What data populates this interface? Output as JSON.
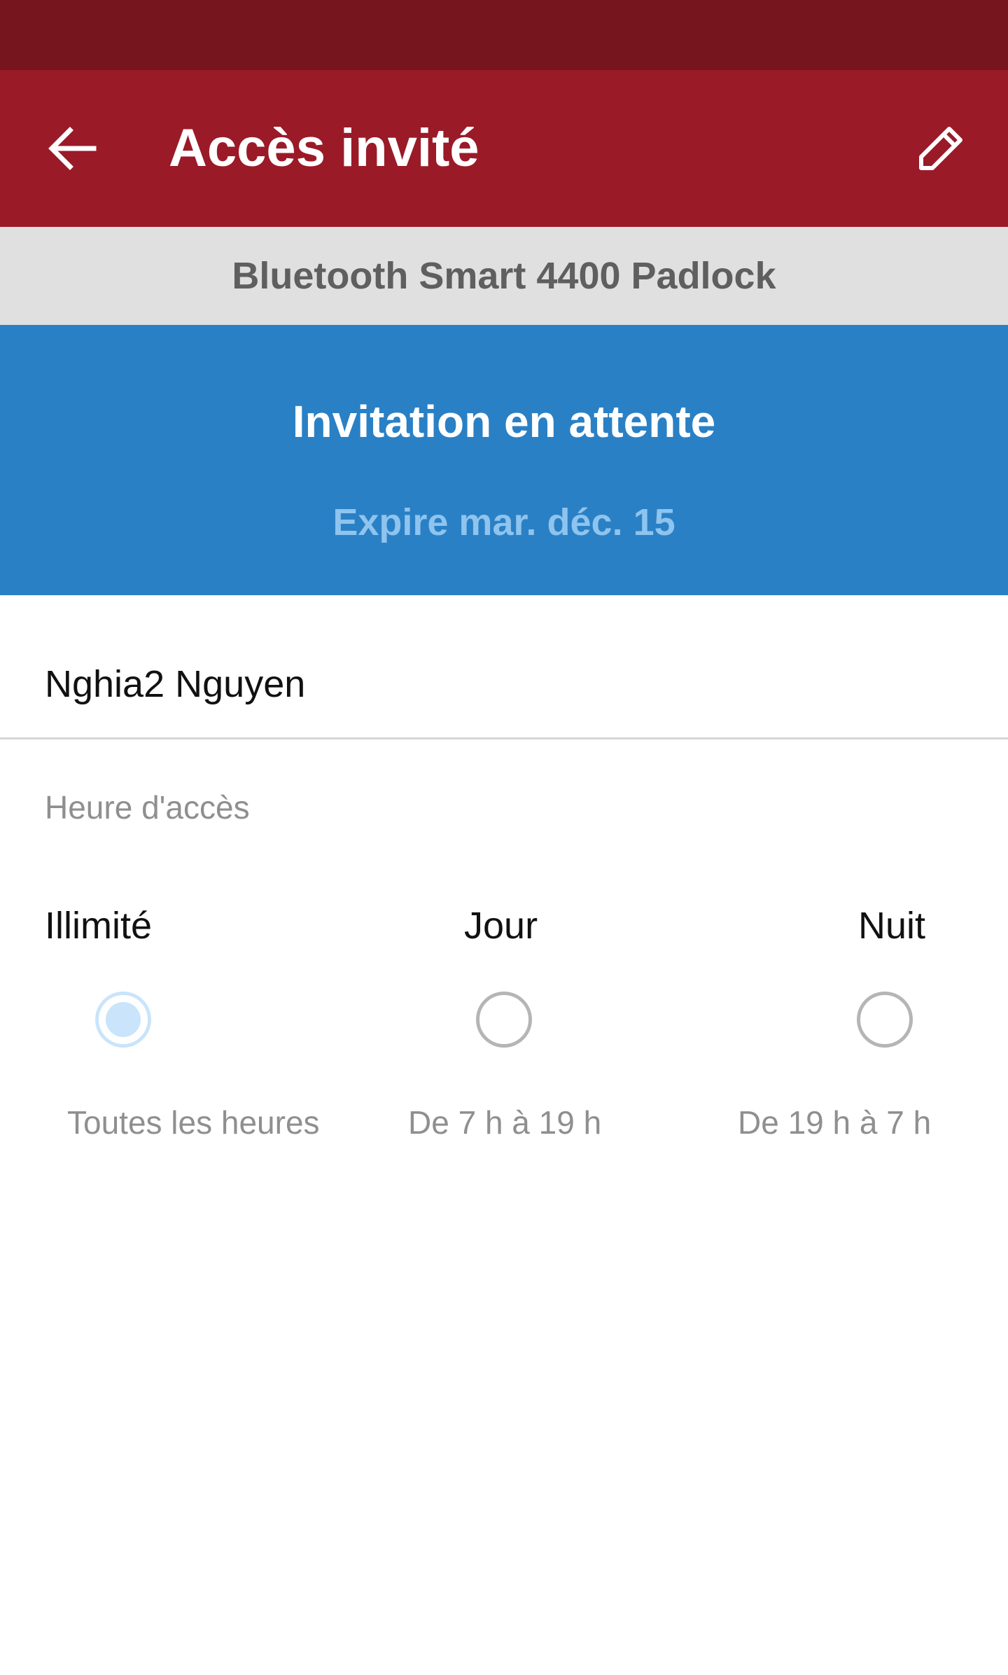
{
  "header": {
    "title": "Accès invité",
    "back_icon": "arrow-left-icon",
    "edit_icon": "pencil-icon"
  },
  "device": {
    "name": "Bluetooth Smart 4400 Padlock"
  },
  "banner": {
    "title": "Invitation en attente",
    "subtitle": "Expire mar. déc. 15"
  },
  "guest": {
    "name": "Nghia2 Nguyen"
  },
  "access": {
    "label": "Heure d'accès",
    "selected": "unlimited",
    "options": [
      {
        "id": "unlimited",
        "title": "Illimité",
        "description": "Toutes les heures"
      },
      {
        "id": "day",
        "title": "Jour",
        "description": "De 7 h à 19 h"
      },
      {
        "id": "night",
        "title": "Nuit",
        "description": "De 19 h à 7 h"
      }
    ]
  },
  "colors": {
    "status_bar": "#76151e",
    "app_bar": "#9b1a28",
    "device_bar": "#e0e0e0",
    "banner": "#2a80c5",
    "banner_subtitle": "#8ec4ee",
    "radio_selected": "#c9e4fb"
  }
}
